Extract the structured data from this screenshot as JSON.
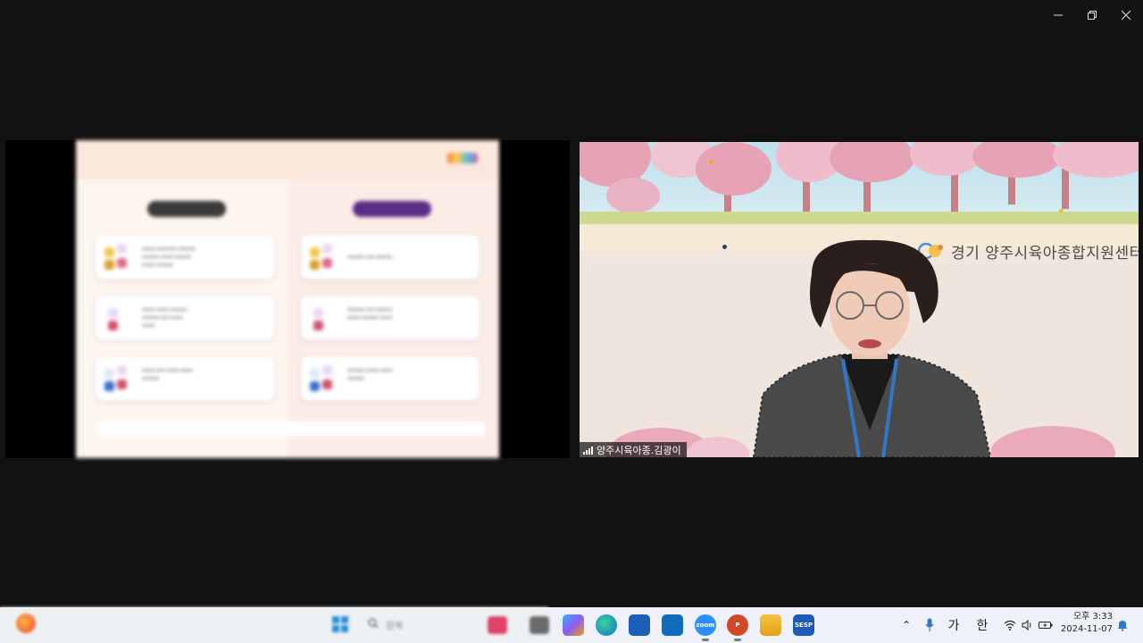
{
  "window_controls": {
    "minimize_icon": "minimize-icon",
    "restore_icon": "restore-icon",
    "close_icon": "close-icon"
  },
  "shared_screen": {
    "subtitle": "",
    "title": "",
    "left_pill": "",
    "right_pill": "",
    "footer": ""
  },
  "video": {
    "banner_text": "경기 양주시육아종합지원센터",
    "participant_name": "양주시육아종.김광이",
    "accent": "#e7a3b6"
  },
  "taskbar": {
    "weather_text": "",
    "search_placeholder": "검색",
    "apps": [
      {
        "name": "copilot",
        "label": ""
      },
      {
        "name": "edge",
        "label": ""
      },
      {
        "name": "store",
        "label": ""
      },
      {
        "name": "outlook",
        "label": ""
      },
      {
        "name": "zoom",
        "label": "zoom"
      },
      {
        "name": "powerpoint",
        "label": "P"
      },
      {
        "name": "file-explorer",
        "label": ""
      },
      {
        "name": "sesp",
        "label": "SESP"
      }
    ],
    "tray": {
      "ime_mode": "가",
      "ime_lang": "한"
    },
    "clock": {
      "time": "오후 3:33",
      "date": "2024-11-07"
    }
  }
}
